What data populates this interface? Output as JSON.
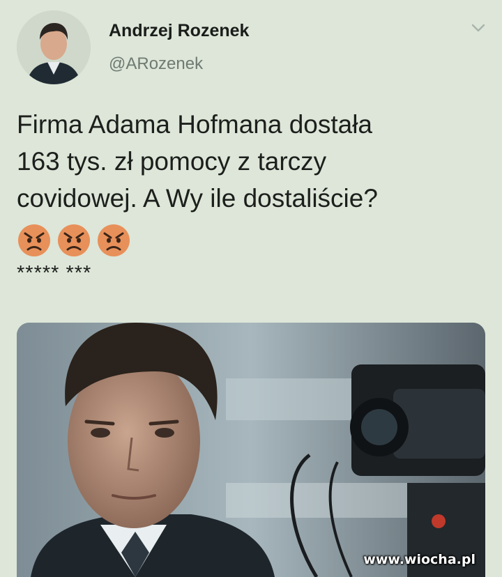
{
  "tweet": {
    "author": {
      "display_name": "Andrzej Rozenek",
      "handle": "@ARozenek",
      "avatar_icon": "person-avatar"
    },
    "menu_icon": "chevron-down-icon",
    "text_lines": [
      "Firma Adama Hofmana dostała",
      "163 tys. zł pomocy z tarczy",
      "covidowej. A Wy ile dostaliście?"
    ],
    "emojis": [
      "angry-face-icon",
      "angry-face-icon",
      "angry-face-icon"
    ],
    "censored_text": "***** ***",
    "media": {
      "description_icon": "photo-of-man-in-suit-with-camera",
      "watermark": "www.wiocha.pl"
    }
  },
  "colors": {
    "background": "#dde6d8",
    "text": "#1c1f1c",
    "handle": "#6f7a72",
    "emoji_face": "#e8905a"
  }
}
